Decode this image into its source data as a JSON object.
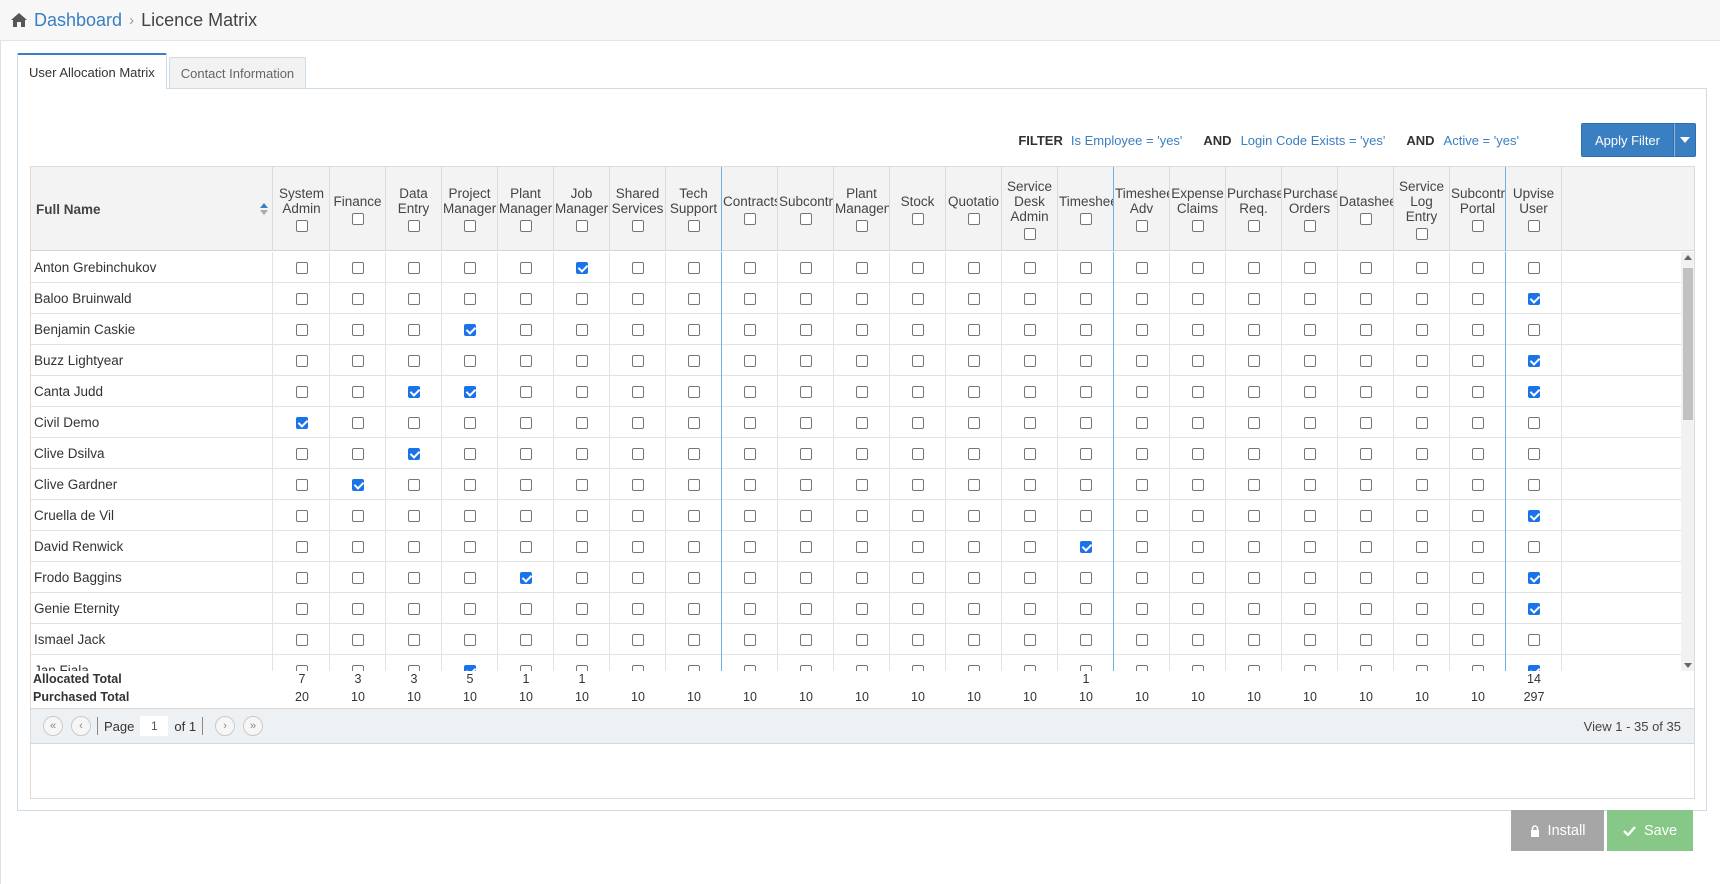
{
  "breadcrumb": {
    "home": "Dashboard",
    "separator": "›",
    "current": "Licence Matrix"
  },
  "tabs": [
    {
      "label": "User Allocation Matrix",
      "active": true
    },
    {
      "label": "Contact Information",
      "active": false
    }
  ],
  "filter": {
    "label": "FILTER",
    "conditions": [
      "Is Employee = 'yes'",
      "Login Code Exists = 'yes'",
      "Active = 'yes'"
    ],
    "joiner": "AND",
    "apply_label": "Apply Filter"
  },
  "grid": {
    "name_header": "Full Name",
    "columns": [
      "System\nAdmin",
      "Finance",
      "Data\nEntry",
      "Project\nManager",
      "Plant\nManager",
      "Job\nManager",
      "Shared\nServices",
      "Tech\nSupport",
      "Contracts",
      "Subcontr",
      "Plant\nManagen",
      "Stock",
      "Quotatio",
      "Service\nDesk\nAdmin",
      "Timeshee",
      "Timeshee\nAdv",
      "Expense\nClaims",
      "Purchase\nReq.",
      "Purchase\nOrders",
      "Datashee",
      "Service\nLog\nEntry",
      "Subcontr\nPortal",
      "Upvise\nUser"
    ],
    "rows": [
      {
        "name": "Anton Grebinchukov",
        "checked": [
          5
        ]
      },
      {
        "name": "Baloo Bruinwald",
        "checked": [
          22
        ]
      },
      {
        "name": "Benjamin Caskie",
        "checked": [
          3
        ]
      },
      {
        "name": "Buzz Lightyear",
        "checked": [
          22
        ]
      },
      {
        "name": "Canta Judd",
        "checked": [
          2,
          3,
          22
        ]
      },
      {
        "name": "Civil Demo",
        "checked": [
          0
        ]
      },
      {
        "name": "Clive Dsilva",
        "checked": [
          2
        ]
      },
      {
        "name": "Clive Gardner",
        "checked": [
          1
        ]
      },
      {
        "name": "Cruella de Vil",
        "checked": [
          22
        ]
      },
      {
        "name": "David Renwick",
        "checked": [
          14
        ]
      },
      {
        "name": "Frodo Baggins",
        "checked": [
          4,
          22
        ]
      },
      {
        "name": "Genie Eternity",
        "checked": [
          22
        ]
      },
      {
        "name": "Ismael Jack",
        "checked": []
      },
      {
        "name": "Jan Fiala",
        "checked": [
          3,
          22
        ]
      }
    ],
    "allocated_label": "Allocated Total",
    "allocated": [
      "7",
      "3",
      "3",
      "5",
      "1",
      "1",
      "",
      "",
      "",
      "",
      "",
      "",
      "",
      "",
      "1",
      "",
      "",
      "",
      "",
      "",
      "",
      "",
      "14"
    ],
    "purchased_label": "Purchased Total",
    "purchased": [
      "20",
      "10",
      "10",
      "10",
      "10",
      "10",
      "10",
      "10",
      "10",
      "10",
      "10",
      "10",
      "10",
      "10",
      "10",
      "10",
      "10",
      "10",
      "10",
      "10",
      "10",
      "10",
      "297"
    ]
  },
  "pager": {
    "page_label": "Page",
    "page_value": "1",
    "of_label": "of 1",
    "view_text": "View 1 - 35 of 35"
  },
  "actions": {
    "install_label": "Install",
    "save_label": "Save"
  },
  "colors": {
    "accent": "#3a7fc1",
    "checkbox": "#1a73e8",
    "save": "#87c787",
    "install": "#a6a6a6"
  }
}
